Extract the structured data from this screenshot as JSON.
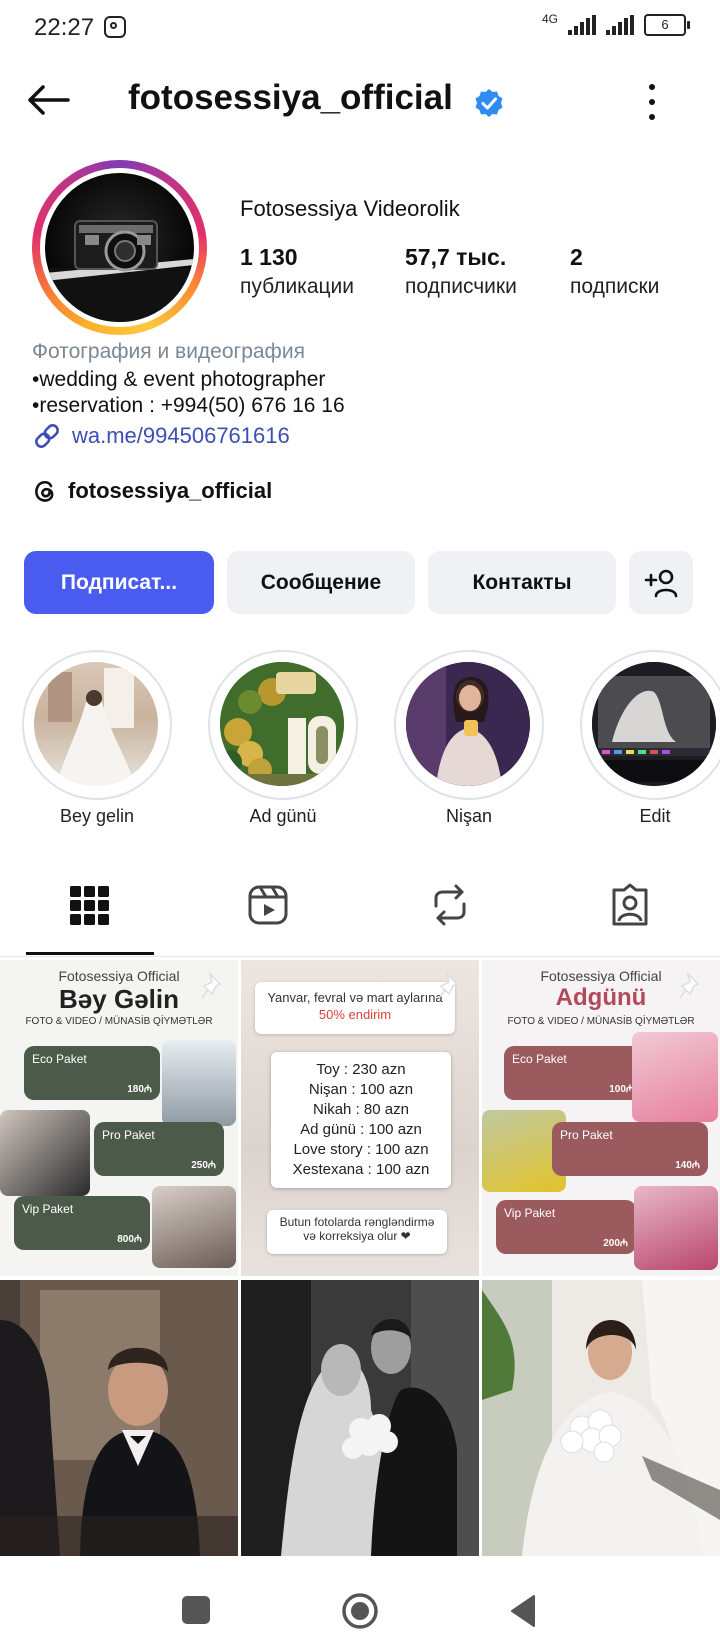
{
  "status_bar": {
    "time": "22:27",
    "network": "4G",
    "battery": "6"
  },
  "header": {
    "username": "fotosessiya_official",
    "verified_icon": "verified-badge-icon"
  },
  "profile": {
    "display_name": "Fotosessiya Videorolik",
    "stats": [
      {
        "number": "1 130",
        "label": "публикации"
      },
      {
        "number": "57,7 тыс.",
        "label": "подписчики"
      },
      {
        "number": "2",
        "label": "подписки"
      }
    ],
    "category": "Фотография и видеография",
    "bio_lines": [
      "•wedding & event photographer",
      "•reservation : +994(50) 676 16 16"
    ],
    "link": "wa.me/994506761616",
    "threads_handle": "fotosessiya_official"
  },
  "actions": {
    "follow": "Подписат...",
    "message": "Сообщение",
    "contacts": "Контакты"
  },
  "highlights": [
    {
      "label": "Bey gelin"
    },
    {
      "label": "Ad günü"
    },
    {
      "label": "Nişan"
    },
    {
      "label": "Edit"
    }
  ],
  "tabs": [
    "grid-icon",
    "reels-icon",
    "reposts-icon",
    "tagged-icon"
  ],
  "posts": {
    "post1": {
      "brand": "Fotosessiya Official",
      "title": "Bəy Gəlin",
      "subtitle": "FOTO & VIDEO / MÜNASİB QİYMƏTLƏR",
      "packages": [
        {
          "name": "Eco Paket",
          "price": "180₼"
        },
        {
          "name": "Pro Paket",
          "price": "250₼"
        },
        {
          "name": "Vip Paket",
          "price": "800₼"
        }
      ]
    },
    "post2": {
      "header": "Yanvar, fevral və mart aylarına",
      "discount": "50% endirim",
      "prices": [
        "Toy : 230 azn",
        "Nişan : 100 azn",
        "Nikah : 80 azn",
        "Ad günü : 100 azn",
        "Love story : 100 azn",
        "Xestexana : 100 azn"
      ],
      "footer": "Butun fotolarda rəngləndirmə və korreksiya olur ❤"
    },
    "post3": {
      "brand": "Fotosessiya Official",
      "title": "Adgünü",
      "subtitle": "FOTO & VIDEO / MÜNASİB QİYMƏTLƏR",
      "packages": [
        {
          "name": "Eco Paket",
          "price": "100₼"
        },
        {
          "name": "Pro Paket",
          "price": "140₼"
        },
        {
          "name": "Vip Paket",
          "price": "200₼"
        }
      ]
    }
  },
  "nav": [
    "recents-square-icon",
    "home-circle-icon",
    "back-triangle-icon"
  ]
}
